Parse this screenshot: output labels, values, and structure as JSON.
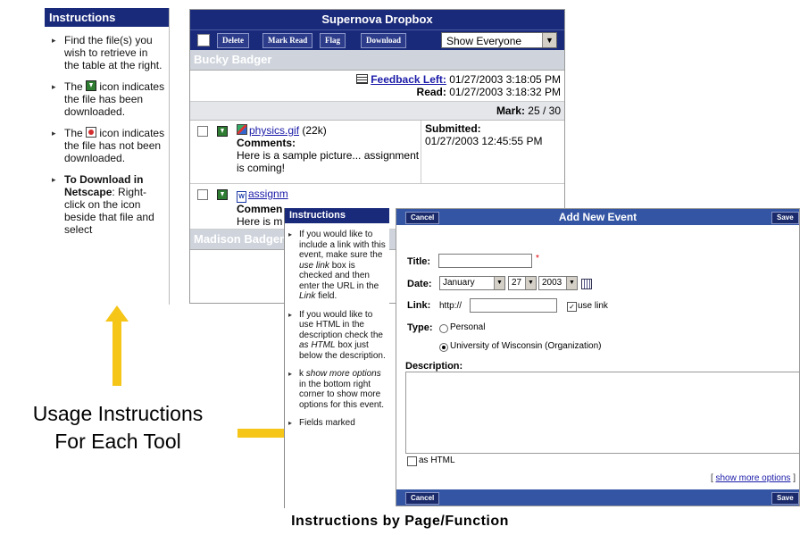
{
  "left_panel": {
    "title": "Instructions",
    "item1": "Find the file(s) you wish to retrieve in the table at the right.",
    "item2_pre": "The",
    "item2_post": "icon indicates the file has been downloaded.",
    "item3_pre": "The",
    "item3_post": "icon indicates the file has not been downloaded.",
    "item4_bold": "To Download in Netscape",
    "item4_rest": ": Right-click on the icon beside that file and select"
  },
  "dropbox": {
    "title": "Supernova Dropbox",
    "toolbar": {
      "delete": "Delete",
      "mark_read": "Mark Read",
      "flag": "Flag",
      "download": "Download",
      "filter_value": "Show Everyone"
    },
    "user1": "Bucky Badger",
    "feedback_link": "Feedback Left:",
    "feedback_date": "01/27/2003 3:18:05 PM",
    "read_label": "Read:",
    "read_date": "01/27/2003 3:18:32 PM",
    "mark_label": "Mark:",
    "mark_value": "25 / 30",
    "file1": {
      "name": "physics.gif",
      "size": "(22k)",
      "comments_label": "Comments:",
      "comments": "Here is a sample picture... assignment is coming!",
      "submitted_label": "Submitted:",
      "submitted_date": "01/27/2003 12:45:55 PM"
    },
    "file2": {
      "name": "assignm",
      "comments_label": "Commen",
      "comments": "Here is m"
    },
    "user2": "Madison Badger"
  },
  "annotation": {
    "line1": "Usage Instructions",
    "line2": "For Each Tool"
  },
  "event_instructions": {
    "title": "Instructions",
    "i1_a": "If you would like to include a link with this event, make sure the",
    "i1_em1": "use link",
    "i1_b": "box is checked and then enter the URL in the",
    "i1_em2": "Link",
    "i1_c": "field.",
    "i2_a": "If you would like to use HTML in the description check the",
    "i2_em": "as HTML",
    "i2_b": "box just below the description.",
    "i3_a": "k",
    "i3_em": "show more options",
    "i3_b": "in the bottom right corner to show more options for this event.",
    "i4": "Fields marked"
  },
  "event_form": {
    "title": "Add New Event",
    "cancel": "Cancel",
    "save": "Save",
    "title_label": "Title:",
    "required_mark": "*",
    "date_label": "Date:",
    "month": "January",
    "day": "27",
    "year": "2003",
    "link_label": "Link:",
    "link_value": "http://",
    "use_link": "use link",
    "type_label": "Type:",
    "type_personal": "Personal",
    "type_org": "University of Wisconsin (Organization)",
    "description_label": "Description:",
    "as_html": "as HTML",
    "bracket_open": "[",
    "show_more": "show more options",
    "bracket_close": "]"
  },
  "caption": "Instructions by Page/Function",
  "colors": {
    "nav": "#1a2a7a",
    "form_bar": "#3355a4",
    "arrow": "#f5c518",
    "link": "#1a1aa8"
  }
}
